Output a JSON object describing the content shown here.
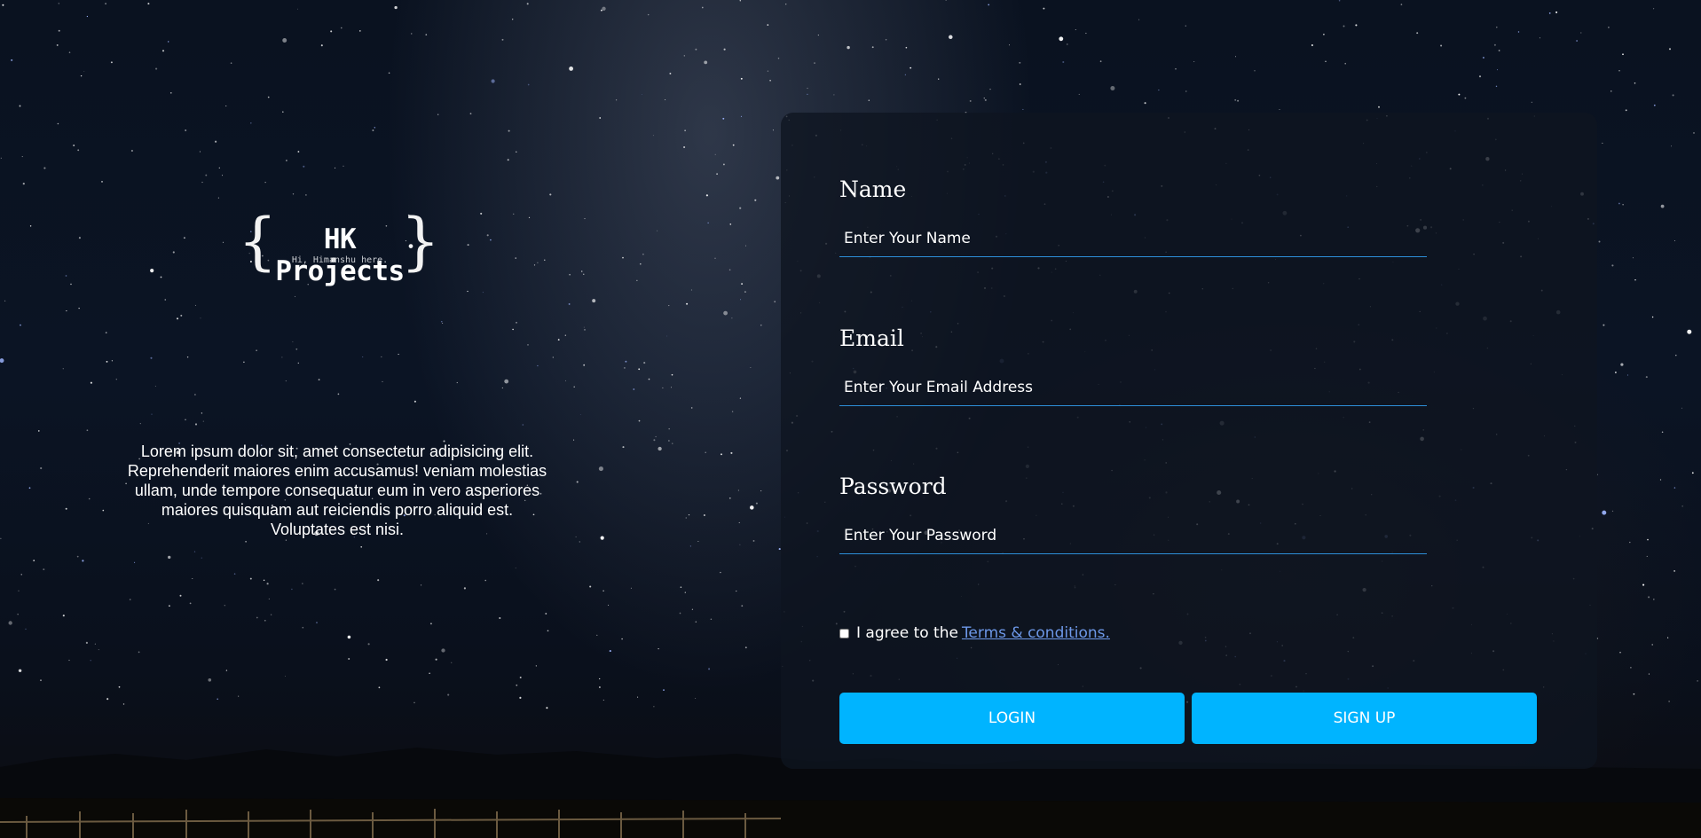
{
  "brand": {
    "title": "HK Projects",
    "subtitle": "Hi, Himanshu here."
  },
  "intro": {
    "text": "Lorem ipsum dolor sit, amet consectetur adipisicing elit. Reprehenderit maiores enim accusamus! veniam molestias ullam, unde tempore consequatur eum in vero asperiores maiores quisquam aut reiciendis porro aliquid est. Voluptates est nisi."
  },
  "form": {
    "name": {
      "label": "Name",
      "placeholder": "Enter Your Name",
      "value": ""
    },
    "email": {
      "label": "Email",
      "placeholder": "Enter Your Email Address",
      "value": ""
    },
    "password": {
      "label": "Password",
      "placeholder": "Enter Your Password",
      "value": ""
    },
    "agree": {
      "checked": false,
      "text": "I agree to the",
      "link_text": "Terms & conditions."
    },
    "buttons": {
      "login": "LOGIN",
      "signup": "SIGN UP"
    }
  },
  "colors": {
    "accent": "#00b4ff",
    "underline": "#2d8fd9",
    "link": "#6d98e8",
    "card_bg": "#0e1420"
  }
}
